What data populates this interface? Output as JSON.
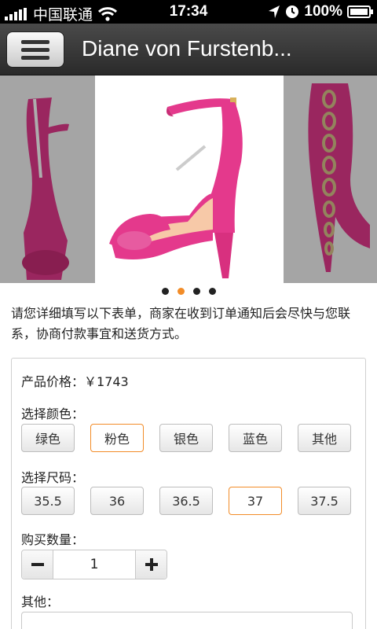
{
  "status_bar": {
    "carrier": "中国联通",
    "time": "17:34",
    "battery": "100%"
  },
  "nav": {
    "title": "Diane von Furstenb..."
  },
  "gallery": {
    "slide_count": 4,
    "active_index": 1,
    "accent_color": "#f28c28",
    "shoe_color": "#e4398c"
  },
  "description": "请您详细填写以下表单，商家在收到订单通知后会尽快与您联系，协商付款事宜和送货方式。",
  "form": {
    "price_label": "产品价格：",
    "price_value": "￥1743",
    "color_label": "选择颜色：",
    "colors": [
      "绿色",
      "粉色",
      "银色",
      "蓝色",
      "其他"
    ],
    "selected_color": "粉色",
    "size_label": "选择尺码：",
    "sizes": [
      "35.5",
      "36",
      "36.5",
      "37",
      "37.5"
    ],
    "selected_size": "37",
    "quantity_label": "购买数量：",
    "quantity": "1",
    "other_label": "其他："
  }
}
